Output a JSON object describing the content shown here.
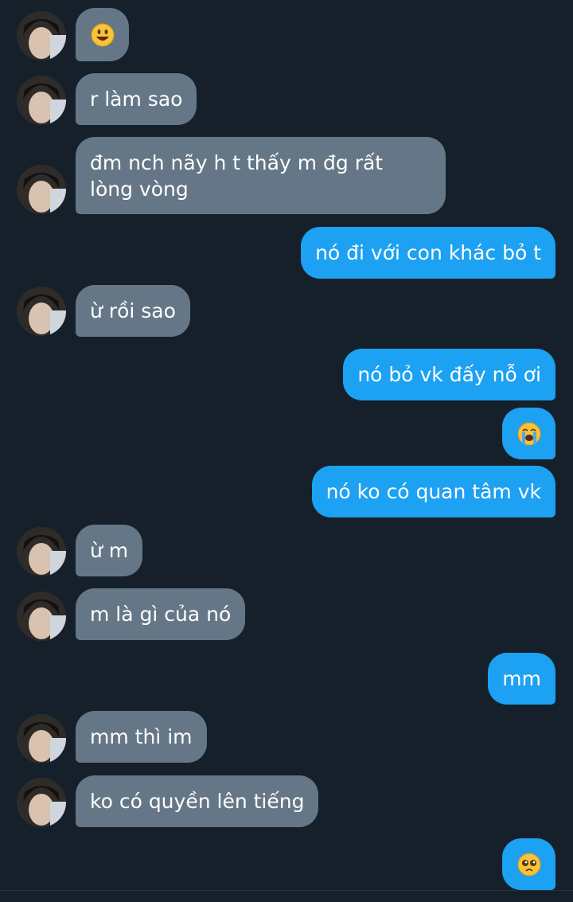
{
  "messages": [
    {
      "from": "them",
      "text": "😃",
      "emoji": "grinning-face"
    },
    {
      "from": "them",
      "text": "r làm sao"
    },
    {
      "from": "them",
      "text": "đm nch nãy h t thấy m đg rất lòng vòng"
    },
    {
      "from": "me",
      "text": "nó đi với con khác bỏ t"
    },
    {
      "from": "them",
      "text": "ừ rồi sao"
    },
    {
      "from": "me",
      "text": "nó bỏ vk đấy nỗ ơi"
    },
    {
      "from": "me",
      "text": "😭",
      "emoji": "loudly-crying-face"
    },
    {
      "from": "me",
      "text": "nó ko có quan tâm vk"
    },
    {
      "from": "them",
      "text": "ừ m"
    },
    {
      "from": "them",
      "text": "m là gì của nó"
    },
    {
      "from": "me",
      "text": "mm"
    },
    {
      "from": "them",
      "text": "mm thì im"
    },
    {
      "from": "them",
      "text": "ko có quyền lên tiếng"
    },
    {
      "from": "me",
      "text": "🥺",
      "emoji": "pleading-face"
    }
  ],
  "colors": {
    "background": "#15202b",
    "incoming_bubble": "#657786",
    "outgoing_bubble": "#1da1f2",
    "text": "#ffffff"
  }
}
